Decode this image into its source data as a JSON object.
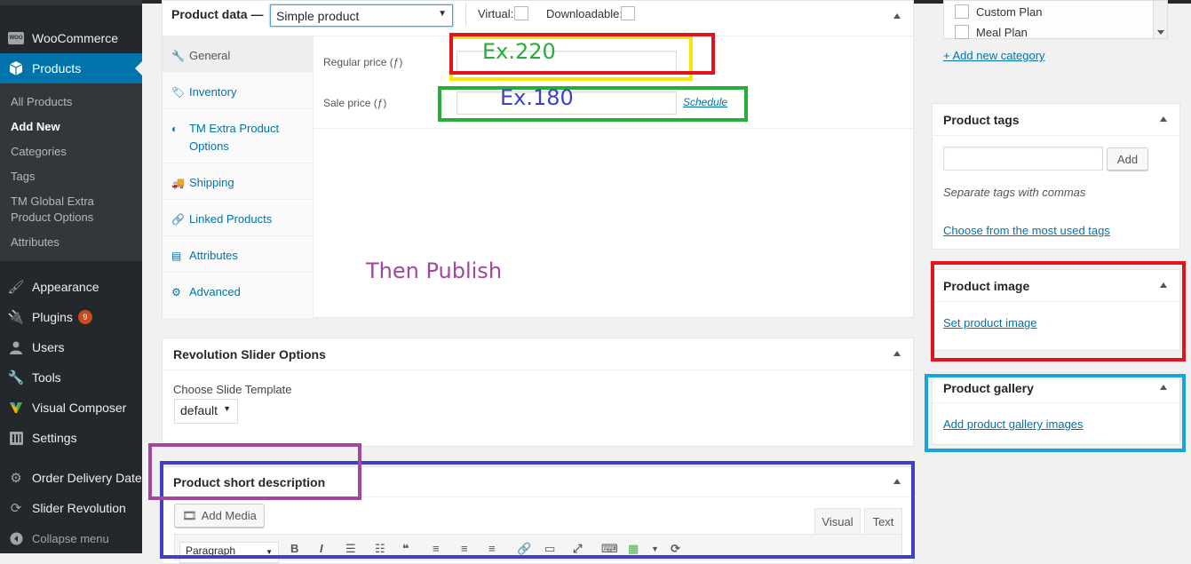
{
  "sidebar": {
    "items": [
      {
        "label": "WooCommerce",
        "icon": "woocommerce-icon"
      },
      {
        "label": "Products",
        "icon": "products-box-icon"
      },
      {
        "label": "Appearance",
        "icon": "paint-brush-icon"
      },
      {
        "label": "Plugins",
        "icon": "plug-icon",
        "badge": "9"
      },
      {
        "label": "Users",
        "icon": "user-icon"
      },
      {
        "label": "Tools",
        "icon": "wrench-icon"
      },
      {
        "label": "Visual Composer",
        "icon": "visual-composer-icon"
      },
      {
        "label": "Settings",
        "icon": "settings-sliders-icon"
      },
      {
        "label": "Order Delivery Date",
        "icon": "gear-icon"
      },
      {
        "label": "Slider Revolution",
        "icon": "refresh-icon"
      },
      {
        "label": "Collapse menu",
        "icon": "collapse-arrow-icon"
      }
    ],
    "woo_badge": "WOO",
    "submenu": [
      "All Products",
      "Add New",
      "Categories",
      "Tags",
      "TM Global Extra Product Options",
      "Attributes"
    ],
    "current_submenu": "Add New"
  },
  "product_data": {
    "title": "Product data —",
    "type_selected": "Simple product",
    "virtual_label": "Virtual:",
    "downloadable_label": "Downloadable:",
    "tabs": [
      "General",
      "Inventory",
      "TM Extra Product Options",
      "Shipping",
      "Linked Products",
      "Attributes",
      "Advanced"
    ],
    "active_tab": "General",
    "regular_price_label": "Regular price (ƒ)",
    "sale_price_label": "Sale price (ƒ)",
    "schedule_link": "Schedule",
    "regular_price_value": "",
    "sale_price_value": ""
  },
  "annotations": {
    "regular_example": "Ex.220",
    "sale_example": "Ex.180",
    "publish_note": "Then Publish",
    "colors": {
      "red": "#e0141e",
      "yellow": "#f5e50a",
      "green": "#27ae3a",
      "blue": "#3f3fc8",
      "purple": "#a2479e",
      "cyan": "#16a4dc"
    }
  },
  "revolution": {
    "title": "Revolution Slider Options",
    "template_label": "Choose Slide Template",
    "template_value": "default"
  },
  "short_description": {
    "title": "Product short description",
    "add_media": "Add Media",
    "tab_visual": "Visual",
    "tab_text": "Text",
    "format_value": "Paragraph"
  },
  "categories": {
    "items": [
      "Custom Plan",
      "Meal Plan"
    ],
    "add_new_link": "+ Add new category"
  },
  "tags": {
    "title": "Product tags",
    "add_button": "Add",
    "hint": "Separate tags with commas",
    "most_used_link": "Choose from the most used tags"
  },
  "product_image": {
    "title": "Product image",
    "set_link": "Set product image"
  },
  "gallery": {
    "title": "Product gallery",
    "add_link": "Add product gallery images"
  }
}
